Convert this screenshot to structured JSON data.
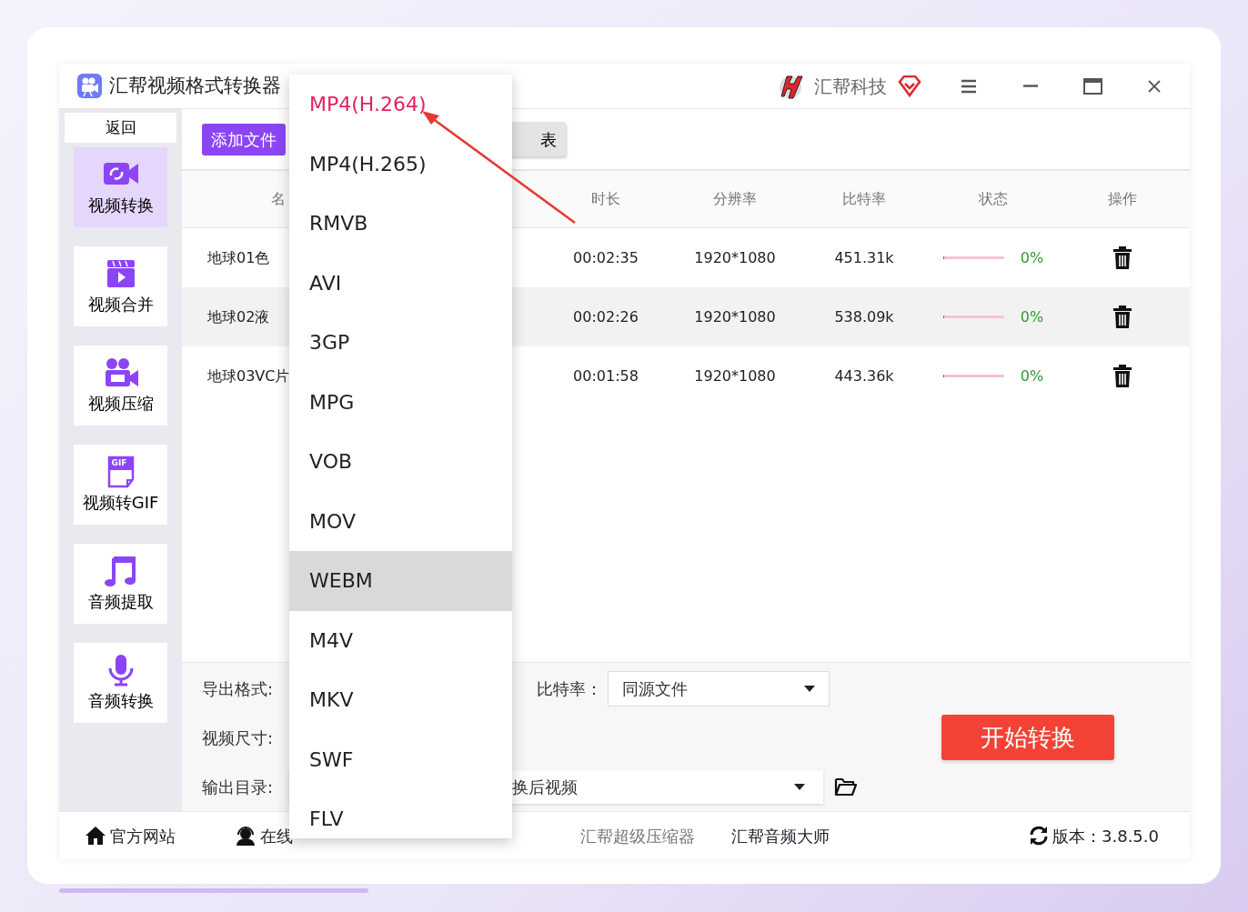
{
  "window": {
    "title": "汇帮视频格式转换器",
    "brand": "汇帮科技"
  },
  "sidebar": {
    "back": "返回",
    "items": [
      {
        "label": "视频转换",
        "selected": true
      },
      {
        "label": "视频合并",
        "selected": false
      },
      {
        "label": "视频压缩",
        "selected": false
      },
      {
        "label": "视频转GIF",
        "selected": false,
        "icon_text": "GIF"
      },
      {
        "label": "音频提取",
        "selected": false
      },
      {
        "label": "音频转换",
        "selected": false
      }
    ]
  },
  "toolbar": {
    "buttons": [
      {
        "label": "添加文件",
        "kind": "primary"
      },
      {
        "label": "表",
        "kind": "secondary"
      }
    ]
  },
  "table": {
    "columns": [
      "名",
      "时长",
      "分辨率",
      "比特率",
      "状态",
      "操作"
    ],
    "rows": [
      {
        "name": "地球01色",
        "duration": "00:02:35",
        "resolution": "1920*1080",
        "bitrate": "451.31k",
        "level": 0,
        "progress": "0%",
        "selected": false
      },
      {
        "name": "地球02液",
        "duration": "00:02:26",
        "resolution": "1920*1080",
        "bitrate": "538.09k",
        "level": 0,
        "progress": "0%",
        "selected": true
      },
      {
        "name": "地球03VC片",
        "duration": "00:01:58",
        "resolution": "1920*1080",
        "bitrate": "443.36k",
        "level": 0,
        "progress": "0%",
        "selected": false
      }
    ]
  },
  "settings": {
    "export_format_label": "导出格式:",
    "video_size_label": "视频尺寸:",
    "output_dir_label": "输出目录:",
    "output_dir": "换后视频",
    "bitrate_label": "比特率：",
    "bitrate": "同源文件",
    "start_button": "开始转换"
  },
  "format_menu": [
    {
      "label": "MP4(H.264)",
      "selected": true,
      "hovered": false
    },
    {
      "label": "MP4(H.265)",
      "selected": false,
      "hovered": false
    },
    {
      "label": "RMVB",
      "selected": false,
      "hovered": false
    },
    {
      "label": "AVI",
      "selected": false,
      "hovered": false
    },
    {
      "label": "3GP",
      "selected": false,
      "hovered": false
    },
    {
      "label": "MPG",
      "selected": false,
      "hovered": false
    },
    {
      "label": "VOB",
      "selected": false,
      "hovered": false
    },
    {
      "label": "MOV",
      "selected": false,
      "hovered": false
    },
    {
      "label": "WEBM",
      "selected": false,
      "hovered": true
    },
    {
      "label": "M4V",
      "selected": false,
      "hovered": false
    },
    {
      "label": "MKV",
      "selected": false,
      "hovered": false
    },
    {
      "label": "SWF",
      "selected": false,
      "hovered": false
    },
    {
      "label": "FLV",
      "selected": false,
      "hovered": false
    }
  ],
  "footer": {
    "links": [
      {
        "label": "官方网站",
        "kind": "home",
        "muted": false
      },
      {
        "label": "在线",
        "kind": "support",
        "muted": false
      },
      {
        "label": "汇帮超级压缩器",
        "kind": "plain",
        "muted": true
      },
      {
        "label": "汇帮音频大师",
        "kind": "plain",
        "muted": false
      }
    ],
    "version": "版本：3.8.5.0"
  }
}
